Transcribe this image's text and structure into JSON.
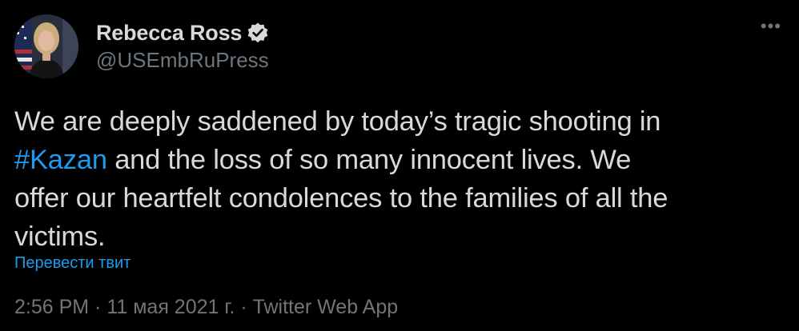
{
  "author": {
    "display_name": "Rebecca Ross",
    "handle": "@USEmbRuPress",
    "avatar_icon": "profile-photo-avatar",
    "verified_icon": "verified-badge-icon"
  },
  "more_icon": "more-options-icon",
  "more_glyph": "•••",
  "tweet": {
    "line1": "We are deeply saddened by today’s tragic shooting in",
    "hashtag": "#Kazan",
    "line2_rest": " and the loss of so many innocent lives.  We",
    "line3": "offer our heartfelt condolences to the families of all the",
    "line4": "victims."
  },
  "translate_label": "Перевести твит",
  "meta": {
    "time": "2:56 PM",
    "sep1": " · ",
    "date": "11 мая 2021 г.",
    "sep2": " · ",
    "source": "Twitter Web App"
  },
  "colors": {
    "background": "#000000",
    "text": "#D9D9D9",
    "secondary": "#6E767D",
    "link": "#1D9BF0"
  }
}
